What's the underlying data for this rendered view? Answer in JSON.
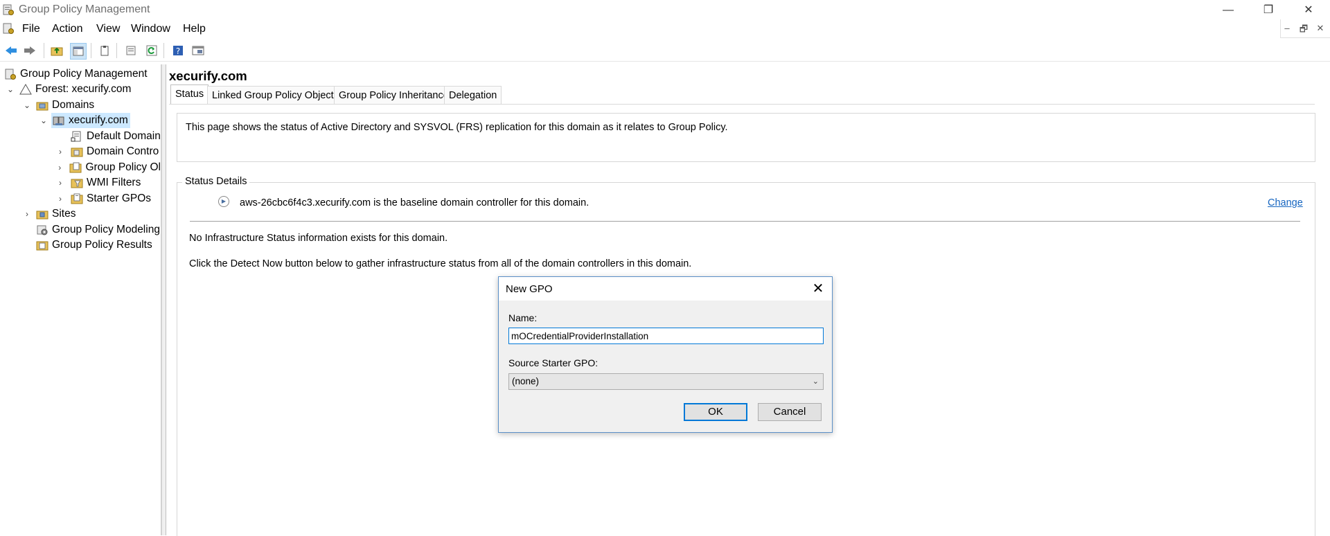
{
  "window": {
    "title": "Group Policy Management",
    "minimize": "—",
    "restore": "❐",
    "close": "✕"
  },
  "menu": {
    "items": [
      "File",
      "Action",
      "View",
      "Window",
      "Help"
    ],
    "mdi": {
      "minimize": "–",
      "restore": "🗗",
      "close": "✕"
    }
  },
  "toolbar": {
    "icons": [
      "back-icon",
      "forward-icon",
      "up-folder-icon",
      "show-hide-tree-icon",
      "clipboard-icon",
      "properties-icon",
      "refresh-icon",
      "help-icon",
      "console-icon"
    ]
  },
  "tree": {
    "root": "Group Policy Management",
    "forest": "Forest: xecurify.com",
    "domains": "Domains",
    "domain": "xecurify.com",
    "children": [
      "Default Domain",
      "Domain Contro",
      "Group Policy Ol",
      "WMI Filters",
      "Starter GPOs"
    ],
    "sites": "Sites",
    "modeling": "Group Policy Modeling",
    "results": "Group Policy Results"
  },
  "main": {
    "title": "xecurify.com",
    "tabs": [
      "Status",
      "Linked Group Policy Objects",
      "Group Policy Inheritance",
      "Delegation"
    ],
    "active_tab": "Status",
    "info": "This page shows the status of Active Directory and SYSVOL (FRS) replication for this domain as it relates to Group Policy.",
    "status_details_label": "Status Details",
    "baseline_text": "aws-26cbc6f4c3.xecurify.com is the baseline domain controller for this domain.",
    "change_link": "Change",
    "no_info": "No Infrastructure Status information exists for this domain.",
    "detect_text": "Click the Detect Now button below to gather infrastructure status from all of the domain controllers in this domain."
  },
  "dialog": {
    "title": "New GPO",
    "close": "✕",
    "name_label": "Name:",
    "name_value": "mOCredentialProviderInstallation",
    "source_label": "Source Starter GPO:",
    "source_value": "(none)",
    "ok": "OK",
    "cancel": "Cancel"
  },
  "colors": {
    "accent": "#0078d7",
    "link": "#1565c0",
    "selection": "#cce8ff"
  }
}
